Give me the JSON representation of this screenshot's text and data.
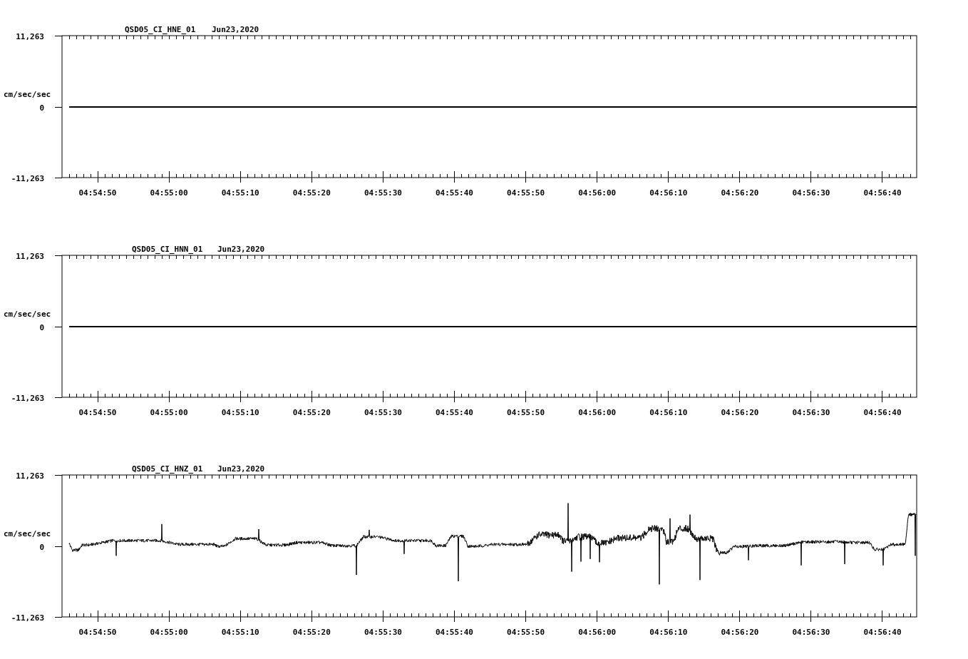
{
  "panels": [
    {
      "station": "QSD05_CI_HNE_01",
      "date": "Jun23,2020",
      "unit": "cm/sec/sec",
      "y_ticks": [
        "11,263",
        "0",
        "-11,263"
      ],
      "x_ticks": [
        "04:54:50",
        "04:55:00",
        "04:55:10",
        "04:55:20",
        "04:55:30",
        "04:55:40",
        "04:55:50",
        "04:56:00",
        "04:56:10",
        "04:56:20",
        "04:56:30",
        "04:56:40"
      ],
      "kind": "flat"
    },
    {
      "station": "QSD05_CI_HNN_01",
      "date": "Jun23,2020",
      "unit": "cm/sec/sec",
      "y_ticks": [
        "11,263",
        "0",
        "-11,263"
      ],
      "x_ticks": [
        "04:54:50",
        "04:55:00",
        "04:55:10",
        "04:55:20",
        "04:55:30",
        "04:55:40",
        "04:55:50",
        "04:56:00",
        "04:56:10",
        "04:56:20",
        "04:56:30",
        "04:56:40"
      ],
      "kind": "flat"
    },
    {
      "station": "QSD05_CI_HNZ_01",
      "date": "Jun23,2020",
      "unit": "cm/sec/sec",
      "y_ticks": [
        "11,263",
        "0",
        "-11,263"
      ],
      "x_ticks": [
        "04:54:50",
        "04:55:00",
        "04:55:10",
        "04:55:20",
        "04:55:30",
        "04:55:40",
        "04:55:50",
        "04:56:00",
        "04:56:10",
        "04:56:20",
        "04:56:30",
        "04:56:40"
      ],
      "kind": "waveform"
    }
  ]
}
